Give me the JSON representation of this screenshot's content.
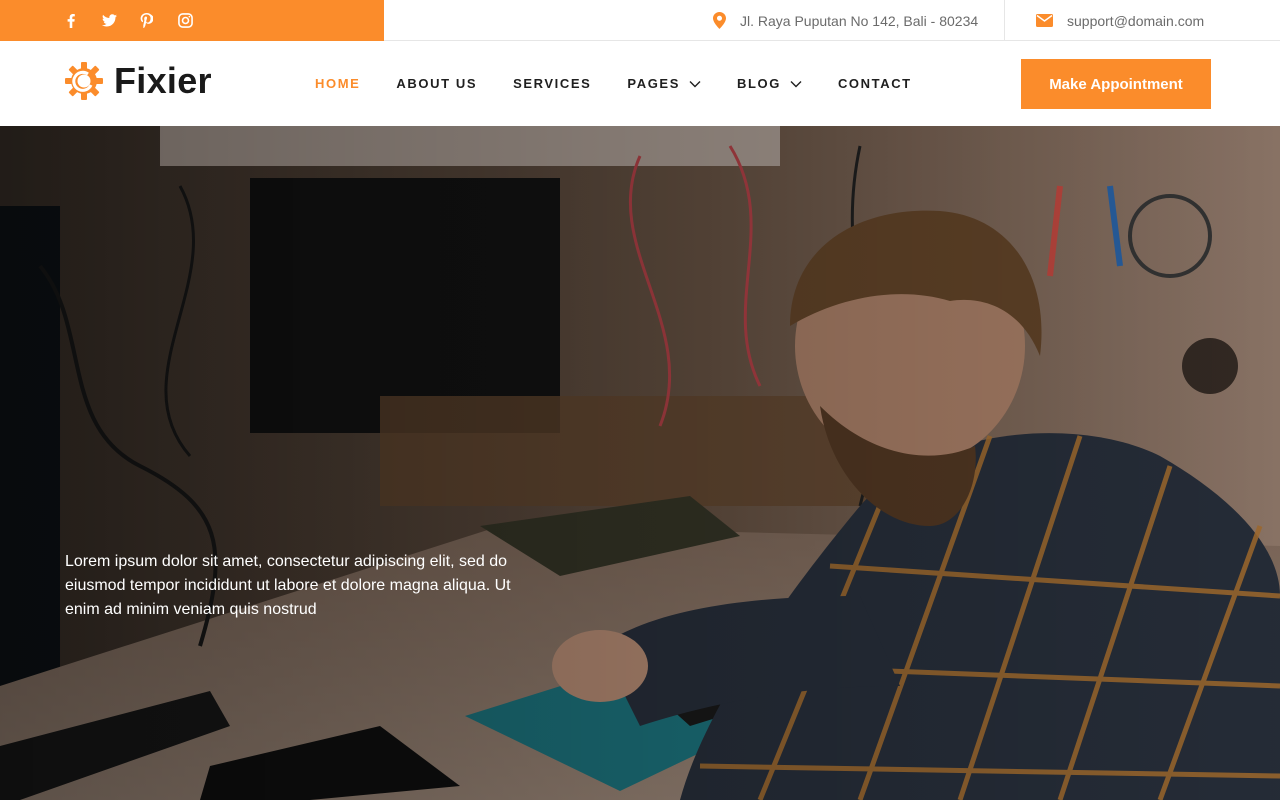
{
  "colors": {
    "accent": "#fb8c2b",
    "text_dark": "#1f1f1f",
    "text_muted": "#6b6b6b"
  },
  "topbar": {
    "social": [
      {
        "name": "facebook",
        "icon": "facebook-icon"
      },
      {
        "name": "twitter",
        "icon": "twitter-icon"
      },
      {
        "name": "pinterest",
        "icon": "pinterest-icon"
      },
      {
        "name": "instagram",
        "icon": "instagram-icon"
      }
    ],
    "address": {
      "icon": "map-pin-icon",
      "text": "Jl. Raya Puputan No 142, Bali - 80234"
    },
    "email": {
      "icon": "envelope-icon",
      "text": "support@domain.com"
    }
  },
  "header": {
    "logo_text": "Fixier",
    "logo_icon": "gear-icon",
    "nav": [
      {
        "label": "HOME",
        "active": true,
        "dropdown": false
      },
      {
        "label": "ABOUT US",
        "active": false,
        "dropdown": false
      },
      {
        "label": "SERVICES",
        "active": false,
        "dropdown": false
      },
      {
        "label": "PAGES",
        "active": false,
        "dropdown": true
      },
      {
        "label": "BLOG",
        "active": false,
        "dropdown": true
      },
      {
        "label": "CONTACT",
        "active": false,
        "dropdown": false
      }
    ],
    "cta_label": "Make Appointment"
  },
  "hero": {
    "text": "Lorem ipsum dolor sit amet, consectetur adipiscing elit, sed do eiusmod tempor incididunt ut labore et dolore magna aliqua. Ut enim ad minim veniam quis nostrud"
  }
}
